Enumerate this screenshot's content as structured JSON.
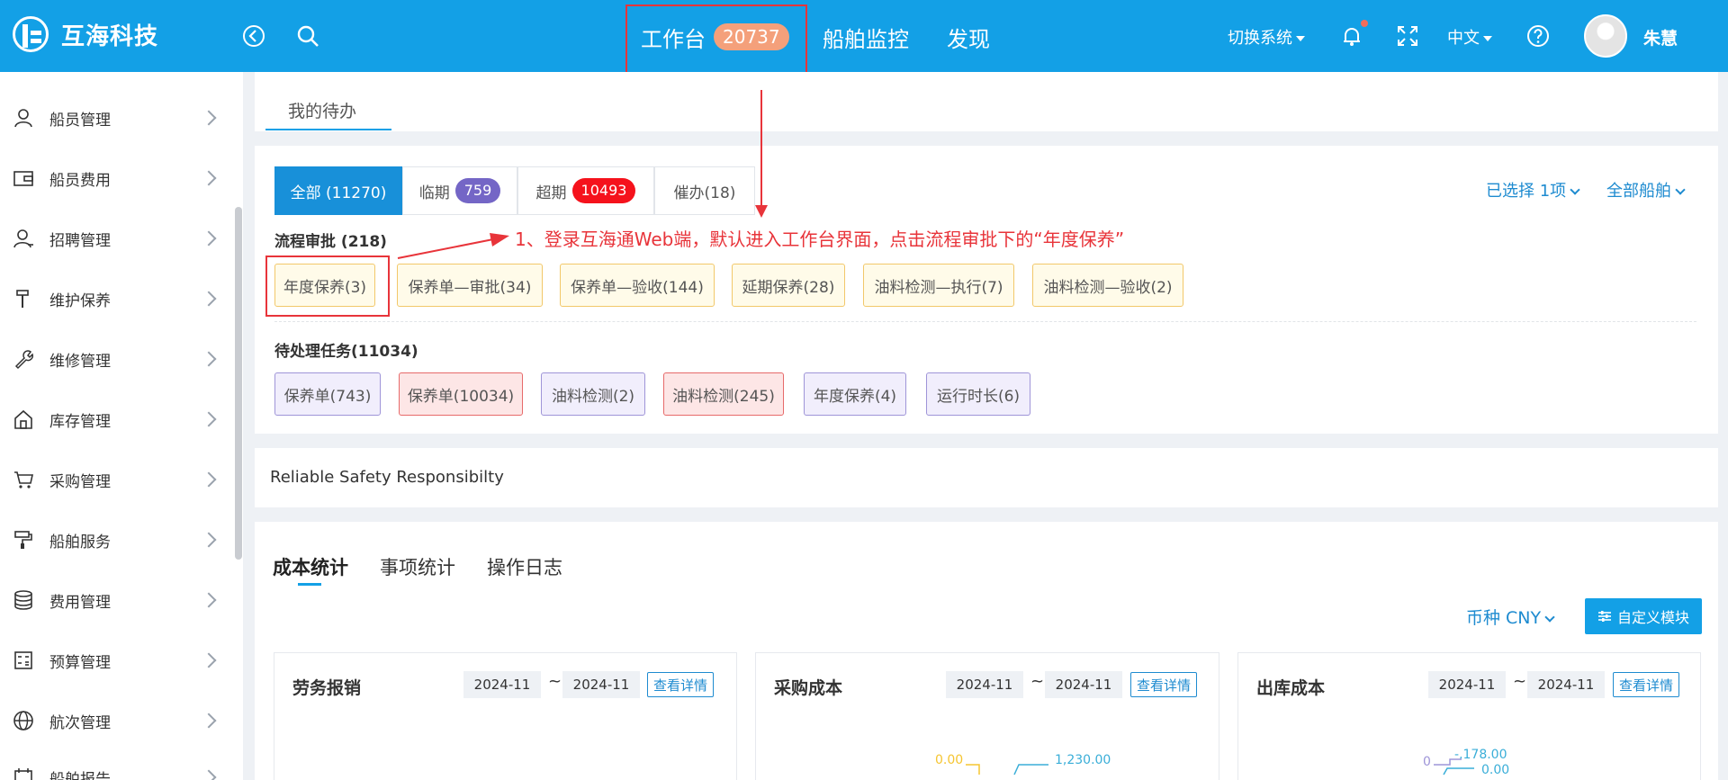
{
  "header": {
    "brand": "互海科技",
    "nav": [
      {
        "label": "工作台",
        "badge": "20737"
      },
      {
        "label": "船舶监控"
      },
      {
        "label": "发现"
      }
    ],
    "system_switch": "切换系统",
    "language": "中文",
    "user_name": "朱慧",
    "accent_color": "#13a0e6"
  },
  "sidebar": {
    "items": [
      {
        "label": "船员管理",
        "icon": "person-icon"
      },
      {
        "label": "船员费用",
        "icon": "wallet-icon"
      },
      {
        "label": "招聘管理",
        "icon": "recruit-icon"
      },
      {
        "label": "维护保养",
        "icon": "hammer-icon"
      },
      {
        "label": "维修管理",
        "icon": "wrench-icon"
      },
      {
        "label": "库存管理",
        "icon": "warehouse-icon"
      },
      {
        "label": "采购管理",
        "icon": "cart-icon"
      },
      {
        "label": "船舶服务",
        "icon": "paint-roller-icon"
      },
      {
        "label": "费用管理",
        "icon": "coins-icon"
      },
      {
        "label": "预算管理",
        "icon": "calculator-icon"
      },
      {
        "label": "航次管理",
        "icon": "globe-icon"
      },
      {
        "label": "船舶报告",
        "icon": "calendar-icon"
      }
    ]
  },
  "tabs": {
    "mine": "我的待办"
  },
  "todo": {
    "segments": [
      {
        "label": "全部 (11270)"
      },
      {
        "label": "临期",
        "badge": "759"
      },
      {
        "label": "超期",
        "badge": "10493"
      },
      {
        "label": "催办(18)"
      }
    ],
    "selected": "已选择 1项",
    "ships": "全部船舶",
    "approval_title": "流程审批 (218)",
    "approval_chips": [
      "年度保养(3)",
      "保养单—审批(34)",
      "保养单—验收(144)",
      "延期保养(28)",
      "油料检测—执行(7)",
      "油料检测—验收(2)"
    ],
    "task_title": "待处理任务(11034)",
    "task_chips": [
      "保养单(743)",
      "保养单(10034)",
      "油料检测(2)",
      "油料检测(245)",
      "年度保养(4)",
      "运行时长(6)"
    ],
    "annotation": "1、登录互海通Web端，默认进入工作台界面，点击流程审批下的“年度保养”"
  },
  "motto": "Reliable Safety Responsibilty",
  "stats": {
    "tabs": [
      "成本统计",
      "事项统计",
      "操作日志"
    ],
    "currency": "币种 CNY",
    "custom_module": "自定义模块",
    "cards": [
      {
        "title": "劳务报销",
        "from": "2024-11",
        "to": "2024-11",
        "detail": "查看详情"
      },
      {
        "title": "采购成本",
        "from": "2024-11",
        "to": "2024-11",
        "detail": "查看详情",
        "value_a": "0.00",
        "value_b": "1,230.00"
      },
      {
        "title": "出库成本",
        "from": "2024-11",
        "to": "2024-11",
        "detail": "查看详情",
        "value_a": "0",
        "value_b": "-,178.00",
        "value_c": "0.00"
      }
    ],
    "tilde": "~"
  }
}
